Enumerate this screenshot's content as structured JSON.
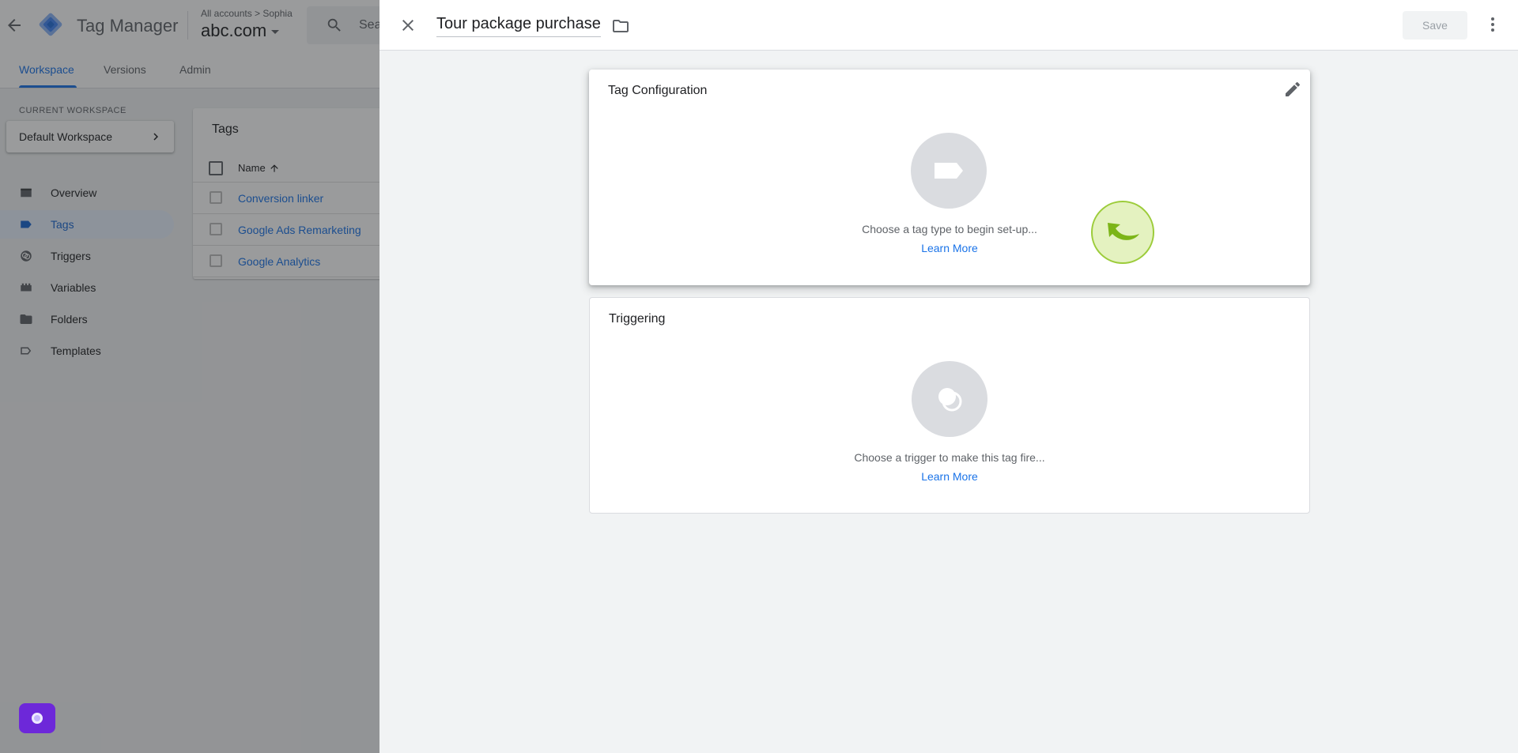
{
  "app": {
    "name": "Tag Manager",
    "breadcrumb": "All accounts > Sophia",
    "container": "abc.com",
    "search_placeholder": "Sea"
  },
  "tabs": [
    {
      "label": "Workspace",
      "active": true
    },
    {
      "label": "Versions",
      "active": false
    },
    {
      "label": "Admin",
      "active": false
    }
  ],
  "sidebar": {
    "workspace_label": "CURRENT WORKSPACE",
    "workspace_name": "Default Workspace",
    "items": [
      {
        "label": "Overview",
        "icon": "overview-icon",
        "active": false
      },
      {
        "label": "Tags",
        "icon": "tag-icon",
        "active": true
      },
      {
        "label": "Triggers",
        "icon": "trigger-icon",
        "active": false
      },
      {
        "label": "Variables",
        "icon": "variables-icon",
        "active": false
      },
      {
        "label": "Folders",
        "icon": "folder-icon",
        "active": false
      },
      {
        "label": "Templates",
        "icon": "templates-icon",
        "active": false
      }
    ]
  },
  "tags_list": {
    "title": "Tags",
    "column_name": "Name",
    "rows": [
      "Conversion linker",
      "Google Ads Remarketing",
      "Google Analytics"
    ]
  },
  "panel": {
    "tag_name": "Tour package purchase",
    "save_label": "Save",
    "config": {
      "title": "Tag Configuration",
      "hint": "Choose a tag type to begin set-up...",
      "learn_more": "Learn More"
    },
    "triggering": {
      "title": "Triggering",
      "hint": "Choose a trigger to make this tag fire...",
      "learn_more": "Learn More"
    }
  },
  "colors": {
    "accent": "#1a73e8",
    "active_nav_bg": "#e8f0fe",
    "panel_bg": "#f1f3f4",
    "cursor_highlight": "#cde88c",
    "chat_button": "#6d28d9"
  }
}
